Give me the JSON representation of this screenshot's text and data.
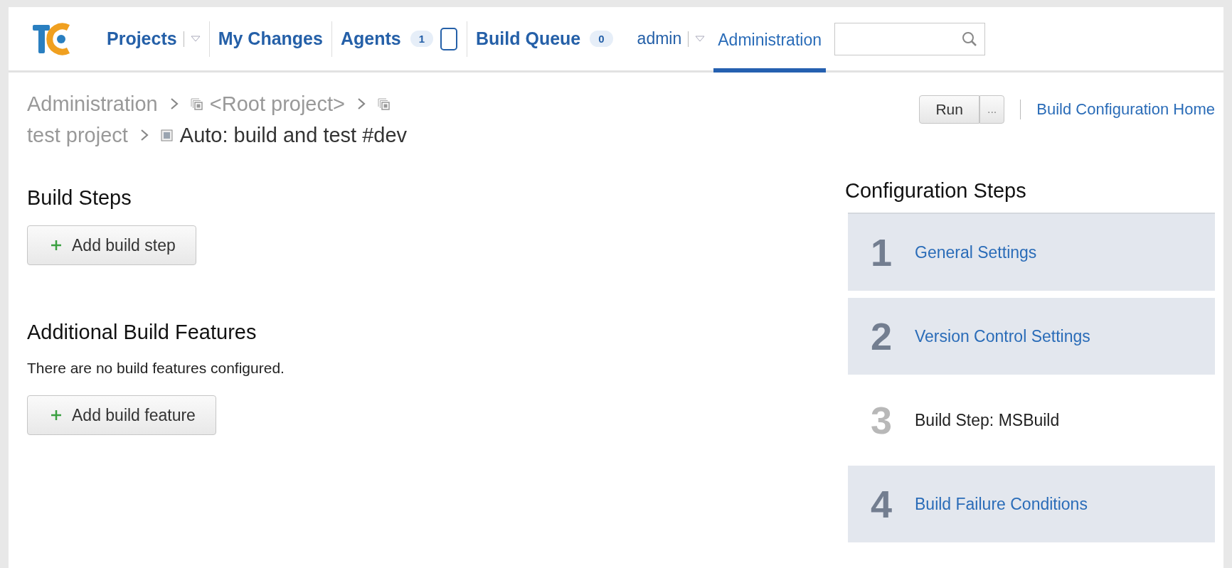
{
  "nav": {
    "items": [
      {
        "label": "Projects",
        "dropdown": true
      },
      {
        "label": "My Changes"
      },
      {
        "label": "Agents",
        "badge": "1",
        "agent_icon": true
      },
      {
        "label": "Build Queue",
        "badge": "0"
      }
    ],
    "user": {
      "label": "admin",
      "dropdown": true
    },
    "tabs": [
      {
        "label": "Administration",
        "selected": true
      }
    ]
  },
  "breadcrumb": [
    {
      "label": "Administration",
      "kind": "plain"
    },
    {
      "label": "<Root project>",
      "kind": "project"
    },
    {
      "label": "test project",
      "kind": "project"
    },
    {
      "label": "Auto: build and test #dev",
      "kind": "config"
    }
  ],
  "actions": {
    "run": "Run",
    "more": "...",
    "home_link": "Build Configuration Home"
  },
  "build_steps": {
    "title": "Build Steps",
    "button": "Add build step"
  },
  "features": {
    "title": "Additional Build Features",
    "message": "There are no build features configured.",
    "button": "Add build feature"
  },
  "config_steps": {
    "title": "Configuration Steps",
    "steps": [
      {
        "number": "1",
        "label": "General Settings",
        "selected": false
      },
      {
        "number": "2",
        "label": "Version Control Settings",
        "selected": false
      },
      {
        "number": "3",
        "label": "Build Step: MSBuild",
        "selected": true
      },
      {
        "number": "4",
        "label": "Build Failure Conditions",
        "selected": false
      }
    ]
  }
}
